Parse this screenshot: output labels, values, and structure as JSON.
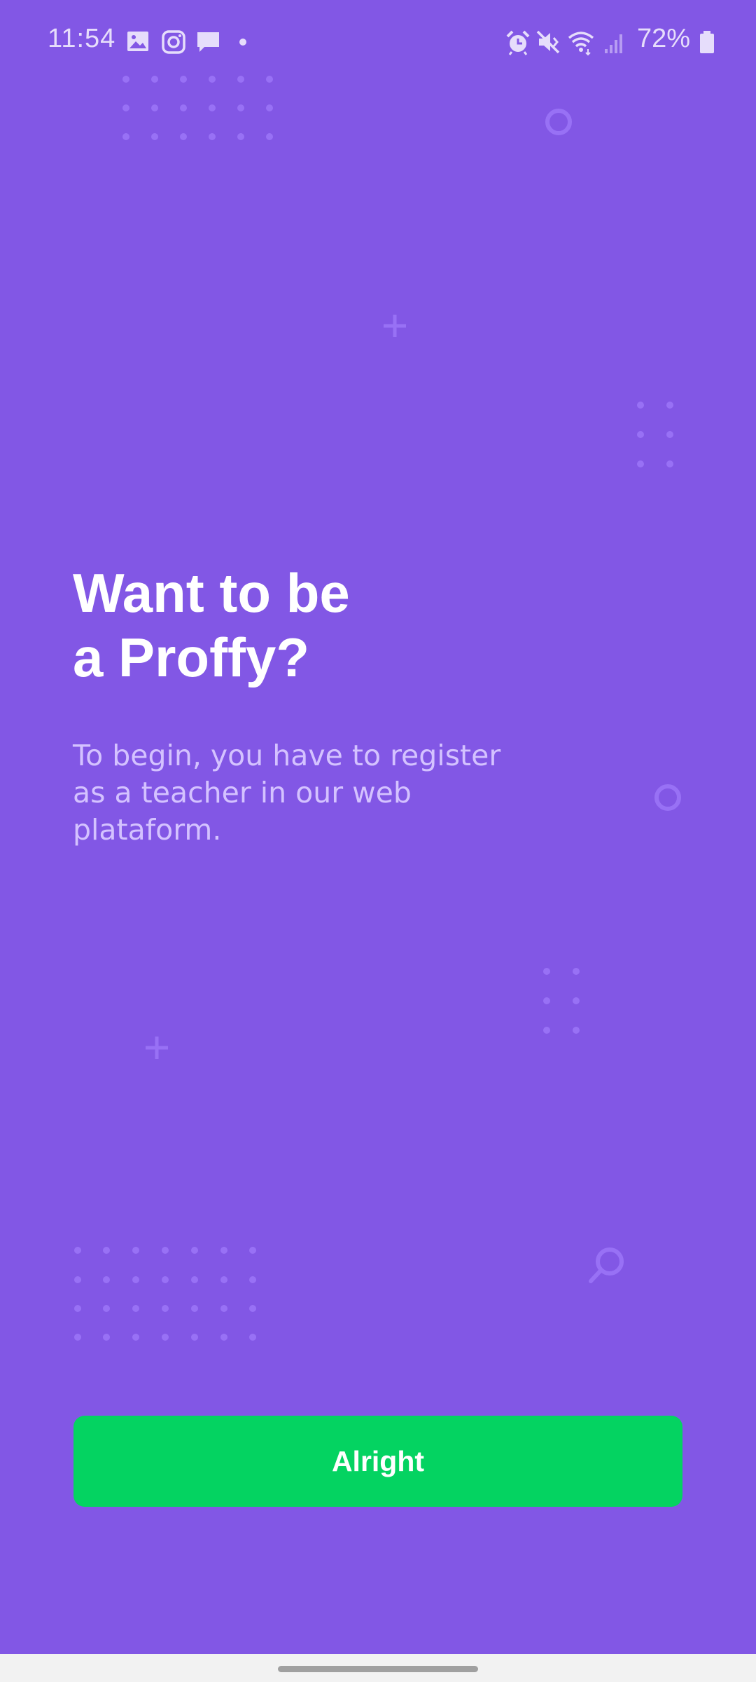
{
  "status_bar": {
    "time": "11:54",
    "battery_percent": "72%",
    "left_icons": [
      "gallery-icon",
      "instagram-icon",
      "message-icon",
      "notification-dot-icon"
    ],
    "right_icons": [
      "alarm-icon",
      "mute-icon",
      "wifi-icon",
      "signal-icon",
      "battery-icon"
    ]
  },
  "onboarding": {
    "title_line1": "Want to be",
    "title_line2": "a Proffy?",
    "description": "To begin, you have to register as a teacher in our web plataform.",
    "button_label": "Alright"
  },
  "colors": {
    "background": "#8257E5",
    "button": "#04D361",
    "title": "#FFFFFF",
    "description": "#D4C2FF",
    "decoration": "#9871F5"
  }
}
